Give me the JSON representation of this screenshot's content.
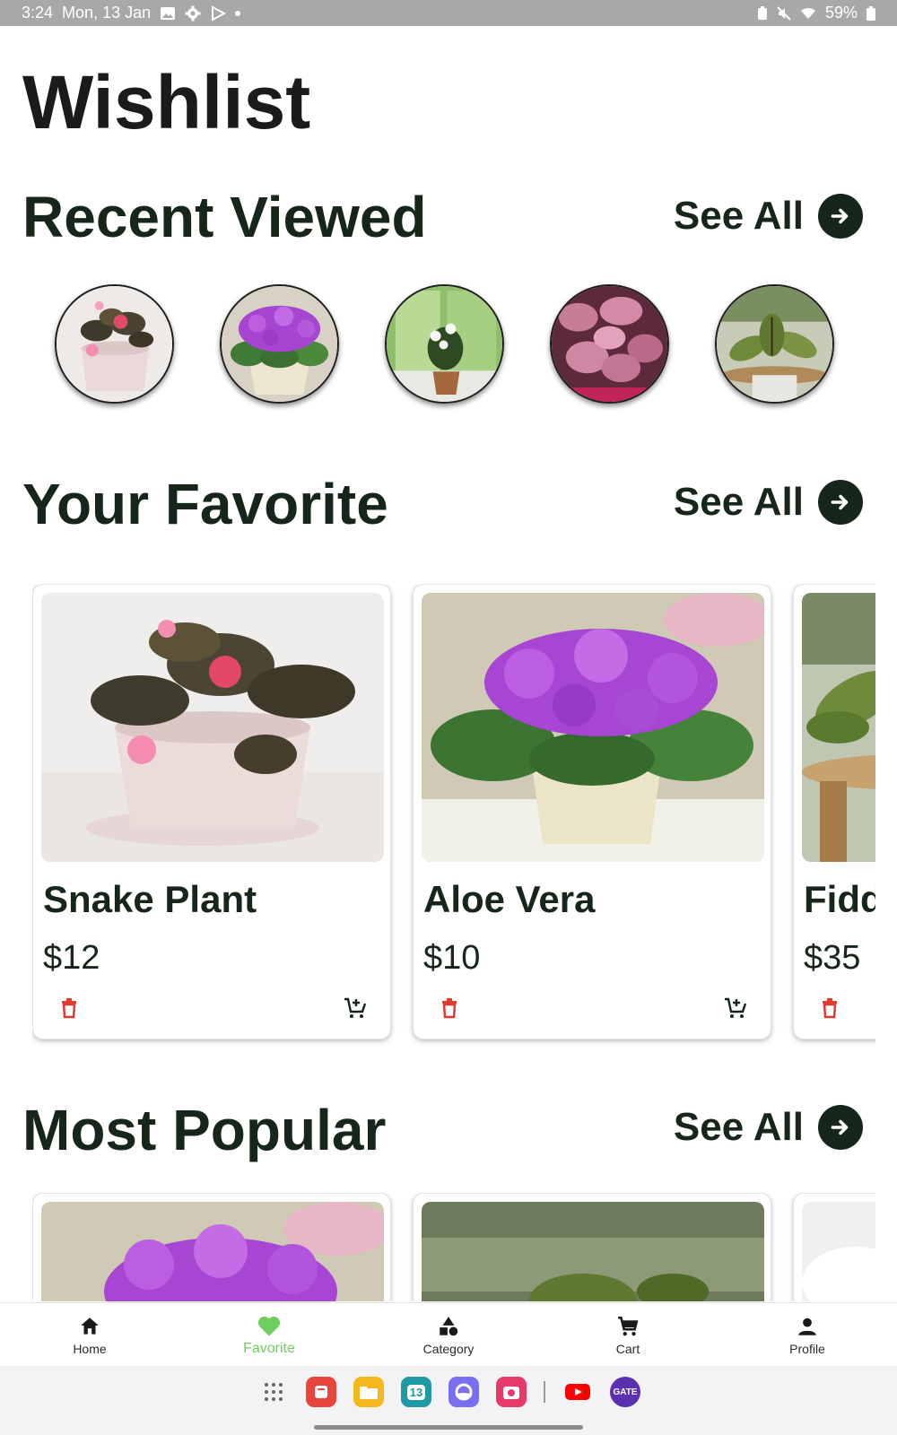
{
  "status_bar": {
    "time": "3:24",
    "date": "Mon, 13 Jan",
    "battery": "59%"
  },
  "page": {
    "title": "Wishlist"
  },
  "recent_viewed": {
    "title": "Recent Viewed",
    "see_all": "See All",
    "items": [
      {
        "name": "begonia-plant-image"
      },
      {
        "name": "violet-plant-image"
      },
      {
        "name": "window-plant-image"
      },
      {
        "name": "pink-polka-plant-image"
      },
      {
        "name": "prayer-plant-image"
      }
    ]
  },
  "your_favorite": {
    "title": "Your Favorite",
    "see_all": "See All",
    "cards": [
      {
        "name": "Snake Plant",
        "price": "$12"
      },
      {
        "name": "Aloe Vera",
        "price": "$10"
      },
      {
        "name": "Fiddle",
        "price": "$35"
      }
    ]
  },
  "most_popular": {
    "title": "Most Popular",
    "see_all": "See All"
  },
  "bottom_nav": {
    "items": [
      {
        "label": "Home",
        "icon": "home-icon"
      },
      {
        "label": "Favorite",
        "icon": "heart-icon",
        "active": true
      },
      {
        "label": "Category",
        "icon": "category-icon"
      },
      {
        "label": "Cart",
        "icon": "cart-icon"
      },
      {
        "label": "Profile",
        "icon": "profile-icon"
      }
    ]
  },
  "taskbar": {
    "calendar_day": "13",
    "gate_badge": "GATE"
  },
  "colors": {
    "primary_dark": "#17261a",
    "favorite_active": "#6fcf5e",
    "delete_red": "#e23a2e"
  }
}
